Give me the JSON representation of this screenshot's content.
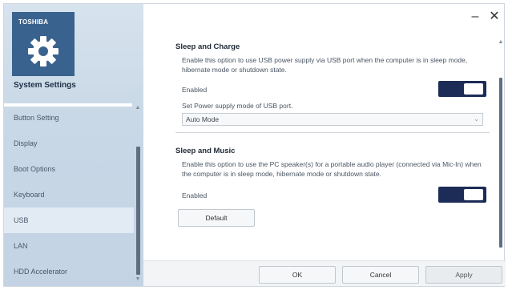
{
  "sidebar": {
    "brand": "TOSHIBA",
    "title": "System Settings",
    "items": [
      {
        "label": "Button Setting"
      },
      {
        "label": "Display"
      },
      {
        "label": "Boot Options"
      },
      {
        "label": "Keyboard"
      },
      {
        "label": "USB"
      },
      {
        "label": "LAN"
      },
      {
        "label": "HDD Accelerator"
      }
    ],
    "active_item": "USB"
  },
  "window": {
    "minimize_label": "–",
    "close_label": "✕"
  },
  "sleep_charge": {
    "title": "Sleep and Charge",
    "description": "Enable this option to use USB power supply via USB port when the computer is in sleep mode, hibernate mode or shutdown state.",
    "enabled_label": "Enabled",
    "enabled": true,
    "mode_label": "Set Power supply mode of USB port.",
    "mode_value": "Auto Mode"
  },
  "sleep_music": {
    "title": "Sleep and Music",
    "description": "Enable this option to use the PC speaker(s) for a portable audio player (connected via Mic-In) when the computer is in sleep mode, hibernate mode or shutdown state.",
    "enabled_label": "Enabled",
    "enabled": true
  },
  "buttons": {
    "default": "Default",
    "ok": "OK",
    "cancel": "Cancel",
    "apply": "Apply"
  },
  "colors": {
    "sidebar_logo": "#3a628f",
    "toggle_on": "#1d2c57",
    "scroll_thumb": "#5f6e80"
  }
}
